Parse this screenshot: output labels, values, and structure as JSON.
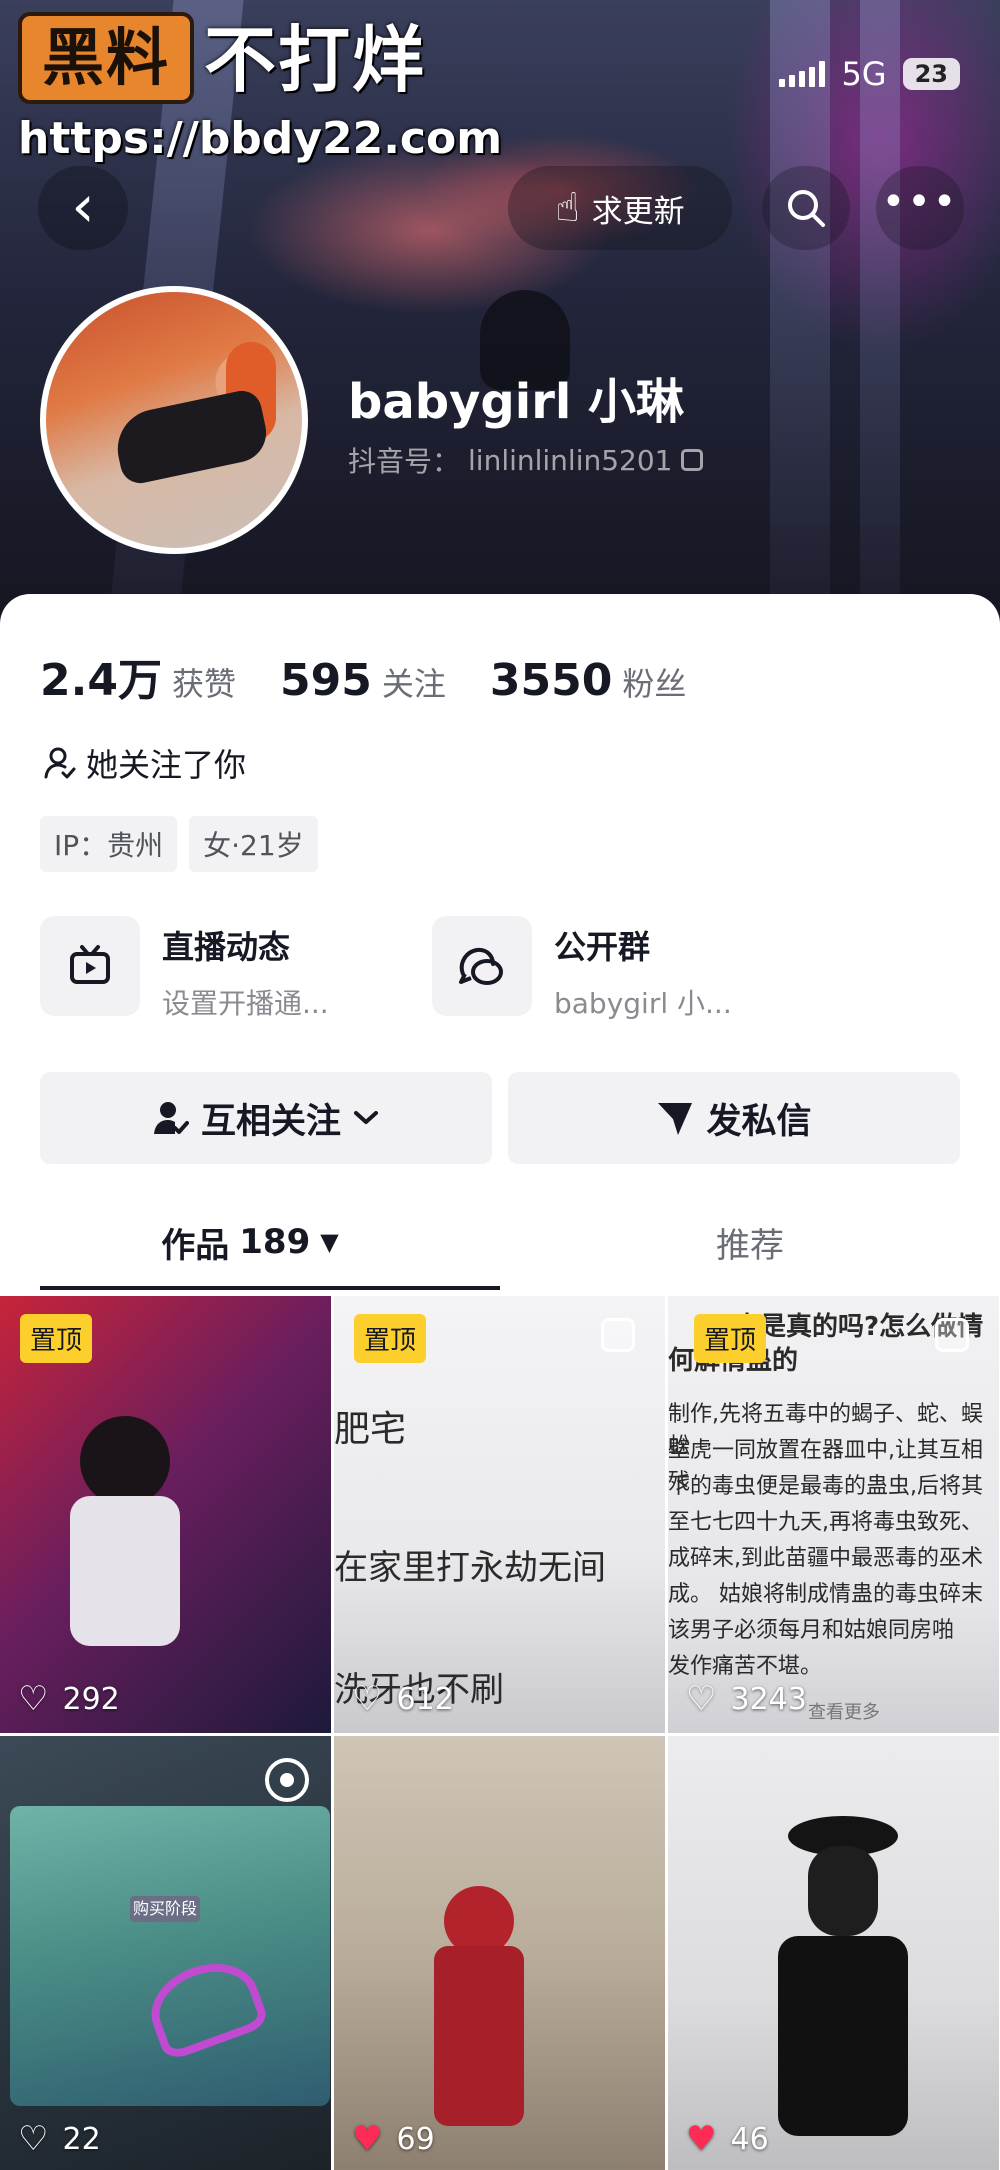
{
  "watermark": {
    "logo_text": "黑料",
    "title": "不打烊",
    "url": "https://bbdy22.com"
  },
  "status_bar": {
    "network": "5G",
    "battery": "23"
  },
  "header": {
    "back_icon": "chevron-left-icon",
    "update_label": "求更新",
    "update_icon": "thumb-point-icon",
    "search_icon": "search-icon",
    "more_icon": "more-dots-icon",
    "more_glyph": "•••"
  },
  "profile": {
    "nickname": "babygirl 小琳",
    "id_prefix": "抖音号：",
    "id": "linlinlinlin5201"
  },
  "stats": [
    {
      "value": "2.4万",
      "label": "获赞"
    },
    {
      "value": "595",
      "label": "关注"
    },
    {
      "value": "3550",
      "label": "粉丝"
    }
  ],
  "follows_you": "她关注了你",
  "tags": [
    "IP：贵州",
    "女·21岁"
  ],
  "features": [
    {
      "title": "直播动态",
      "subtitle": "设置开播通...",
      "icon": "tv-icon"
    },
    {
      "title": "公开群",
      "subtitle": "babygirl 小...",
      "icon": "group-chat-icon"
    }
  ],
  "actions": {
    "mutual_follow": "互相关注",
    "message": "发私信"
  },
  "tabs": {
    "works_label": "作品",
    "works_count": "189",
    "works_arrow": "▼",
    "recommend_label": "推荐"
  },
  "videos": [
    {
      "pinned": "置顶",
      "likes": "292"
    },
    {
      "pinned": "置顶",
      "likes": "612",
      "lines": [
        "肥宅",
        "在家里打永劫无间",
        "洗牙也不刷"
      ]
    },
    {
      "pinned": "置顶",
      "likes": "3243",
      "lines": [
        "蛊是真的吗?怎么做情",
        "何解情蛊的",
        "制作,先将五毒中的蝎子、蛇、蜈蚣",
        "壁虎一同放置在器皿中,让其互相残",
        "下的毒虫便是最毒的蛊虫,后将其",
        "至七七四十九天,再将毒虫致死、",
        "成碎末,到此苗疆中最恶毒的巫术",
        "成。 姑娘将制成情蛊的毒虫碎末",
        "该男子必须每月和姑娘同房啪",
        "发作痛苦不堪。"
      ],
      "more": "查看更多"
    },
    {
      "likes": "22",
      "screen_text": "购买阶段"
    },
    {
      "likes": "69"
    },
    {
      "likes": "46"
    }
  ]
}
